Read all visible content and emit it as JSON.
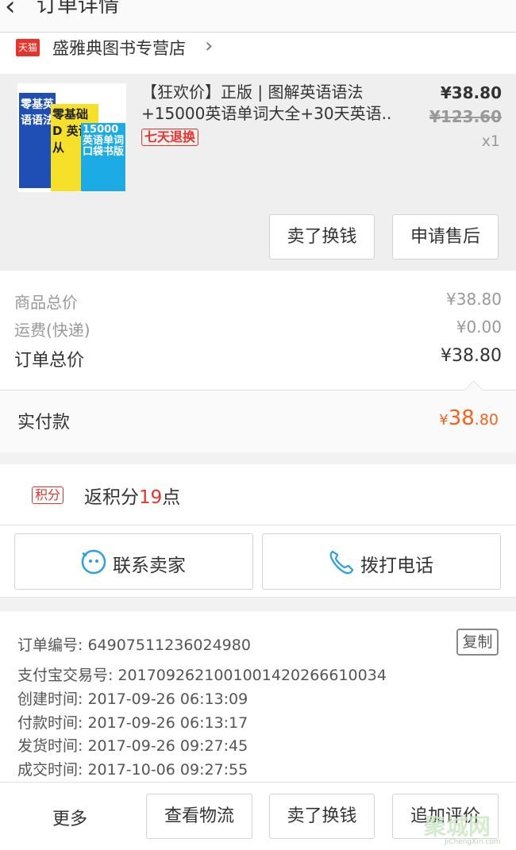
{
  "header": {
    "back_icon": "‹",
    "title": "订单详情",
    "more_icon": "···"
  },
  "shop": {
    "badge": "天猫",
    "name": "盛雅典图书专营店",
    "chevron": "›"
  },
  "product": {
    "title": "【狂欢价】正版 | 图解英语语法+15000英语单词大全+30天英语..",
    "return_tag": "七天退换",
    "price": "¥38.80",
    "original_price": "¥123.60",
    "quantity": "x1",
    "cover_text": {
      "book1": "零基英语语法",
      "book2": "零基础 D 英语从",
      "book3": "15000 英语单词 口袋书版"
    },
    "buttons": {
      "sell": "卖了换钱",
      "after_sales": "申请售后"
    }
  },
  "summary": {
    "goods_total_label": "商品总价",
    "goods_total_value": "¥38.80",
    "shipping_label": "运费(快递)",
    "shipping_value": "¥0.00",
    "order_total_label": "订单总价",
    "order_total_value": "¥38.80",
    "paid_label": "实付款",
    "paid_symbol": "¥",
    "paid_int": "38",
    "paid_dec": ".80"
  },
  "points": {
    "tag": "积分",
    "prefix": "返积分",
    "number": "19",
    "suffix": "点"
  },
  "contact": {
    "seller": "联系卖家",
    "call": "拨打电话"
  },
  "info": {
    "lines": [
      "订单编号: 64907511236024980",
      "支付宝交易号: 2017092621001001420266610034",
      "创建时间: 2017-09-26 06:13:09",
      "付款时间: 2017-09-26 06:13:17",
      "发货时间: 2017-09-26 09:27:45",
      "成交时间: 2017-10-06 09:27:55"
    ],
    "copy": "复制"
  },
  "bottom": {
    "more": "更多",
    "logistics": "查看物流",
    "sell": "卖了换钱",
    "review": "追加评价"
  },
  "watermark": {
    "text": "聚城网",
    "url": "JiChengXin.com"
  },
  "colors": {
    "accent_red": "#e8332b",
    "paid_orange": "#f4621e",
    "icon_blue": "#2a9fe8"
  }
}
